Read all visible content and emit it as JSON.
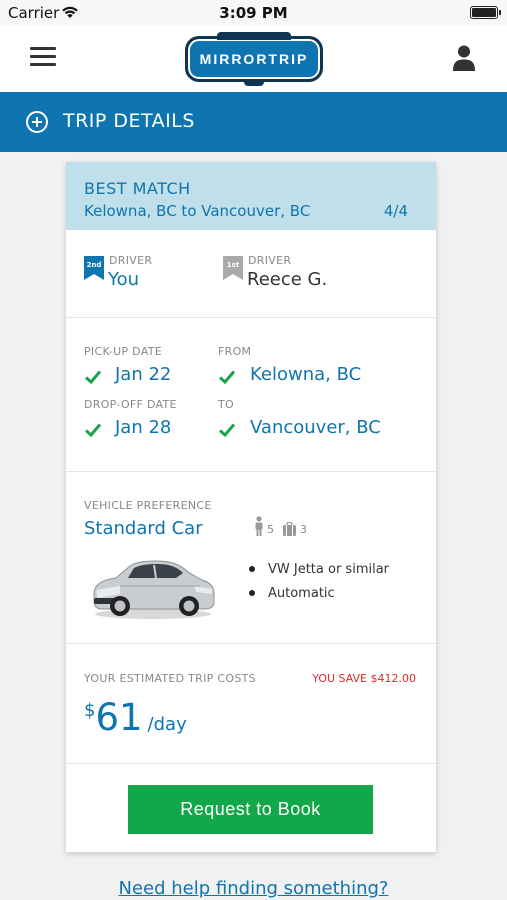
{
  "status_bar": {
    "carrier": "Carrier",
    "time": "3:09 PM"
  },
  "header": {
    "logo_text": "MIRRORTRIP"
  },
  "trip_bar": {
    "label": "TRIP DETAILS"
  },
  "match": {
    "title": "BEST MATCH",
    "route": "Kelowna, BC to Vancouver, BC",
    "count": "4/4"
  },
  "drivers": [
    {
      "rank": "2nd",
      "label": "DRIVER",
      "name": "You"
    },
    {
      "rank": "1st",
      "label": "DRIVER",
      "name": "Reece G."
    }
  ],
  "dates": {
    "pickup_label": "PICK-UP DATE",
    "pickup_value": "Jan 22",
    "from_label": "FROM",
    "from_value": "Kelowna, BC",
    "dropoff_label": "DROP-OFF DATE",
    "dropoff_value": "Jan 28",
    "to_label": "TO",
    "to_value": "Vancouver, BC"
  },
  "vehicle": {
    "label": "VEHICLE PREFERENCE",
    "type": "Standard Car",
    "passengers": "5",
    "luggage": "3",
    "features": [
      "VW Jetta or similar",
      "Automatic"
    ]
  },
  "costs": {
    "label": "YOUR ESTIMATED TRIP COSTS",
    "savings": "YOU SAVE $412.00",
    "currency": "$",
    "amount": "61",
    "unit": "/day"
  },
  "book_button": "Request to Book",
  "help_link": "Need help finding something?",
  "colors": {
    "brand_blue": "#0f75b0",
    "match_bg": "#bfdfea",
    "book_green": "#12a84a",
    "save_red": "#e02828",
    "check_green": "#19a34a"
  }
}
